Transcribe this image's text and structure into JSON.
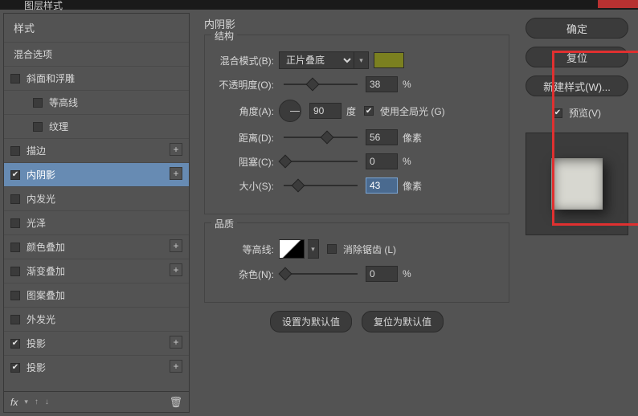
{
  "window": {
    "title": "图层样式"
  },
  "sidebar": {
    "heading": "样式",
    "blend_options": "混合选项",
    "items": [
      {
        "label": "斜面和浮雕",
        "checked": false,
        "plus": false,
        "indent": false
      },
      {
        "label": "等高线",
        "checked": false,
        "plus": false,
        "indent": true
      },
      {
        "label": "纹理",
        "checked": false,
        "plus": false,
        "indent": true
      },
      {
        "label": "描边",
        "checked": false,
        "plus": true,
        "indent": false
      },
      {
        "label": "内阴影",
        "checked": true,
        "plus": true,
        "indent": false,
        "selected": true
      },
      {
        "label": "内发光",
        "checked": false,
        "plus": false,
        "indent": false
      },
      {
        "label": "光泽",
        "checked": false,
        "plus": false,
        "indent": false
      },
      {
        "label": "颜色叠加",
        "checked": false,
        "plus": true,
        "indent": false
      },
      {
        "label": "渐变叠加",
        "checked": false,
        "plus": true,
        "indent": false
      },
      {
        "label": "图案叠加",
        "checked": false,
        "plus": false,
        "indent": false
      },
      {
        "label": "外发光",
        "checked": false,
        "plus": false,
        "indent": false
      },
      {
        "label": "投影",
        "checked": true,
        "plus": true,
        "indent": false
      },
      {
        "label": "投影",
        "checked": true,
        "plus": true,
        "indent": false
      }
    ],
    "fx": "fx"
  },
  "panel": {
    "title": "内阴影",
    "group_structure": "结构",
    "blend_mode_label": "混合模式(B):",
    "blend_mode_value": "正片叠底",
    "opacity_label": "不透明度(O):",
    "opacity_value": "38",
    "pct": "%",
    "angle_label": "角度(A):",
    "angle_value": "90",
    "deg": "度",
    "global_light": "使用全局光 (G)",
    "distance_label": "距离(D):",
    "distance_value": "56",
    "px": "像素",
    "choke_label": "阻塞(C):",
    "choke_value": "0",
    "size_label": "大小(S):",
    "size_value": "43",
    "group_quality": "品质",
    "contour_label": "等高线:",
    "antialias": "消除锯齿 (L)",
    "noise_label": "杂色(N):",
    "noise_value": "0",
    "make_default": "设置为默认值",
    "reset_default": "复位为默认值",
    "swatch_color": "#7b8020"
  },
  "right": {
    "ok": "确定",
    "cancel": "复位",
    "new_style": "新建样式(W)...",
    "preview": "预览(V)"
  }
}
